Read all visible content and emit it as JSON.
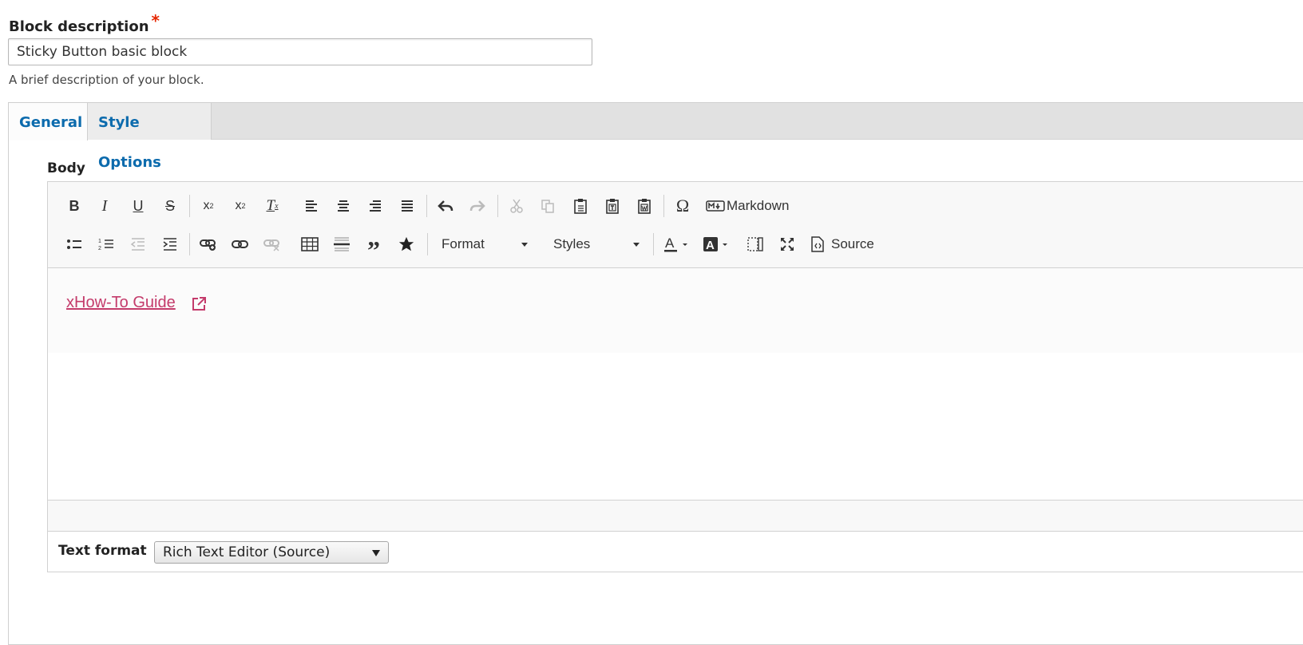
{
  "block_description": {
    "label": "Block description",
    "required_mark": "*",
    "value": "Sticky Button basic block",
    "help": "A brief description of your block."
  },
  "tabs": [
    {
      "label": "General",
      "active": true
    },
    {
      "label": "Style Options",
      "active": false
    }
  ],
  "body": {
    "label": "Body",
    "toolbar": {
      "format_label": "Format",
      "styles_label": "Styles",
      "markdown_label": "Markdown",
      "source_label": "Source"
    },
    "content_link": "xHow-To Guide"
  },
  "text_format": {
    "label": "Text format",
    "selected": "Rich Text Editor (Source)"
  },
  "colors": {
    "accent": "#0c6bad",
    "link": "#c43b6b",
    "required": "#e62600"
  }
}
